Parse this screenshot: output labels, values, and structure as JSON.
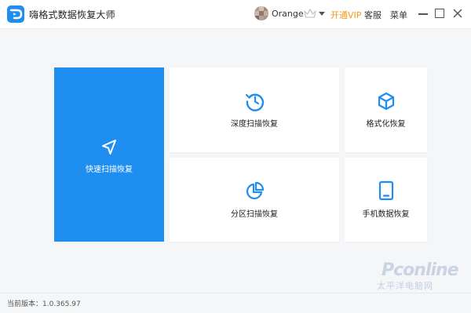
{
  "app": {
    "title": "嗨格式数据恢复大师",
    "logo_icon": "app-logo-icon"
  },
  "header": {
    "username": "Orange",
    "vip_label": "开通VIP",
    "service_label": "客服",
    "menu_label": "菜单",
    "avatar_icon": "avatar-image",
    "crown_icon": "crown-icon",
    "dropdown_icon": "chevron-down-icon",
    "vip_color": "#f09a1a"
  },
  "cards": [
    {
      "id": "quick-scan",
      "label": "快速扫描恢复",
      "icon": "navigation-arrow-icon",
      "primary": true
    },
    {
      "id": "deep-scan",
      "label": "深度扫描恢复",
      "icon": "history-clock-icon"
    },
    {
      "id": "format",
      "label": "格式化恢复",
      "icon": "cube-icon"
    },
    {
      "id": "partition",
      "label": "分区扫描恢复",
      "icon": "pie-chart-icon"
    },
    {
      "id": "phone",
      "label": "手机数据恢复",
      "icon": "mobile-phone-icon"
    }
  ],
  "status": {
    "version_text": "当前版本：1.0.365.97"
  },
  "watermark": {
    "brand": "Pconline",
    "subtitle": "太平洋电脑网"
  },
  "colors": {
    "accent": "#1f8ef1",
    "background": "#f5f6f8",
    "card": "#ffffff"
  }
}
